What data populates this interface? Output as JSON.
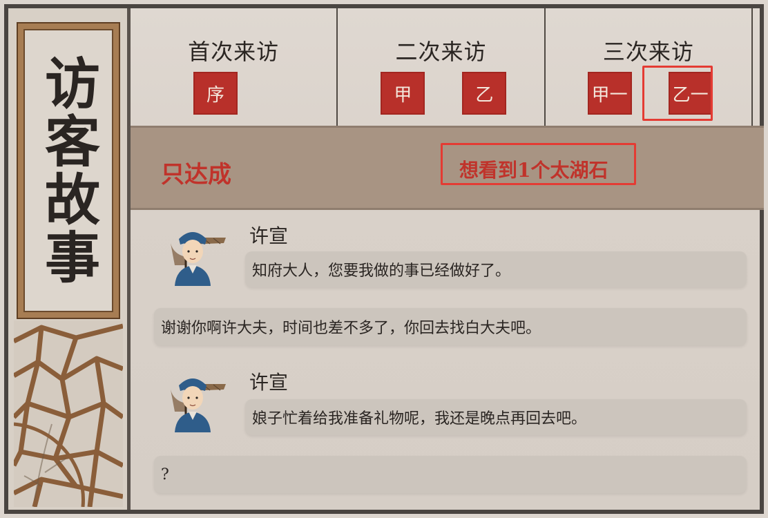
{
  "panel": {
    "title": "访客故事"
  },
  "visits": [
    {
      "title": "首次来访",
      "badges": [
        "序"
      ]
    },
    {
      "title": "二次来访",
      "badges": [
        "甲",
        "乙"
      ]
    },
    {
      "title": "三次来访",
      "badges": [
        "甲一",
        "乙一"
      ]
    }
  ],
  "condition": {
    "label": "只达成",
    "value": "想看到1个太湖石"
  },
  "dialogue": {
    "speaker1": "许宣",
    "line1": "知府大人，您要我做的事已经做好了。",
    "reply1": "谢谢你啊许大夫，时间也差不多了，你回去找白大夫吧。",
    "speaker2": "许宣",
    "line2": "娘子忙着给我准备礼物呢，我还是晚点再回去吧。",
    "reply2": "?"
  },
  "colors": {
    "badge": "#b8302a",
    "highlight": "#e43b33",
    "condition_text": "#c0332b",
    "condition_bar": "#a89483"
  }
}
